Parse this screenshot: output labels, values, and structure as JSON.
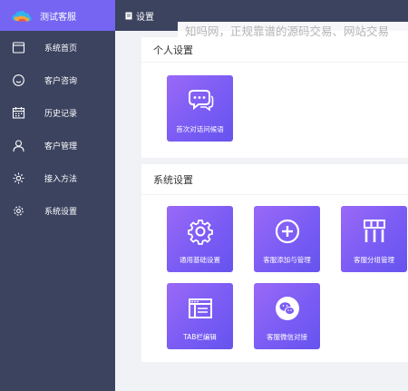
{
  "brand": {
    "name": "测试客服"
  },
  "topbar": {
    "breadcrumb": "设置"
  },
  "watermark": {
    "text": "知吗网，正规靠谱的源码交易、网站交易"
  },
  "sidebar": {
    "items": [
      {
        "label": "系统首页",
        "icon": "window-icon"
      },
      {
        "label": "客户咨询",
        "icon": "smile-icon"
      },
      {
        "label": "历史记录",
        "icon": "calendar-icon"
      },
      {
        "label": "客户管理",
        "icon": "user-icon"
      },
      {
        "label": "接入方法",
        "icon": "gear-icon"
      },
      {
        "label": "系统设置",
        "icon": "cog-icon"
      }
    ]
  },
  "personal": {
    "title": "个人设置",
    "tiles": [
      {
        "label": "首次对话问候语",
        "icon": "chat-bubbles-icon"
      }
    ]
  },
  "system": {
    "title": "系统设置",
    "tiles": [
      {
        "label": "通用基础设置",
        "icon": "gear-icon"
      },
      {
        "label": "客服添加与管理",
        "icon": "plus-circle-icon"
      },
      {
        "label": "客服分组管理",
        "icon": "columns-icon"
      },
      {
        "label": "TAB栏编辑",
        "icon": "browser-window-icon"
      },
      {
        "label": "客服微信对接",
        "icon": "wechat-icon"
      }
    ]
  },
  "colors": {
    "sidebar_bg": "#3b435f",
    "brand_bg": "#7565f2",
    "tile_gradient_start": "#9a69f7",
    "tile_gradient_end": "#6653ee",
    "page_bg": "#f0f2f5"
  }
}
